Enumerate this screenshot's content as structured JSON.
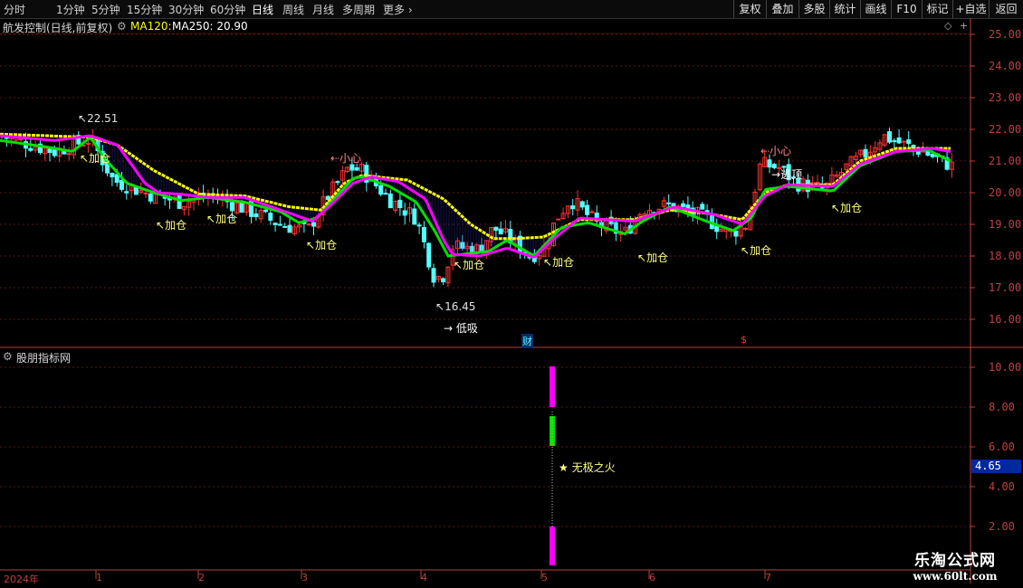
{
  "toolbar": {
    "periods": [
      "分时",
      "1分钟",
      "5分钟",
      "15分钟",
      "30分钟",
      "60分钟",
      "日线",
      "周线",
      "月线",
      "多周期",
      "更多 ›"
    ],
    "active_period": "日线",
    "right_buttons": [
      "复权",
      "叠加",
      "多股",
      "统计",
      "画线",
      "F10",
      "标记",
      "+自选",
      "返回"
    ]
  },
  "main_chart": {
    "title": "航发控制(日线,前复权)",
    "indicators_text": "MA120: MA250: 20.90",
    "ma120_label": "MA120:",
    "ma250_label": "MA250: 20.90",
    "y_axis": [
      "25.00",
      "24.00",
      "23.00",
      "22.00",
      "21.00",
      "20.00",
      "19.00",
      "18.00",
      "17.00",
      "16.00"
    ],
    "high_label": "22.51",
    "low_label": "16.45",
    "low_signal": "→ 低吸",
    "caution_labels": [
      "小心",
      "小心"
    ],
    "escape_label": "逃顶",
    "add_labels": [
      "加仓",
      "加仓",
      "加仓",
      "加仓",
      "加仓",
      "加仓",
      "加仓",
      "加仓",
      "加仓"
    ],
    "markers": [
      "财",
      "$"
    ]
  },
  "sub_chart": {
    "title": "股朋指标网",
    "y_axis": [
      "10.00",
      "8.00",
      "6.00",
      "4.00",
      "2.00"
    ],
    "current_value": "4.65",
    "signal_label": "★ 无极之火"
  },
  "x_axis": {
    "labels": [
      "2024年",
      "1",
      "2",
      "3",
      "4",
      "5",
      "6",
      "7"
    ]
  },
  "watermark": {
    "title": "乐淘公式网",
    "url": "www.60lt.com"
  },
  "colors": {
    "up": "#ff3232",
    "down": "#54ffff",
    "ma_fast": "#00e000",
    "ma_mid": "#ff00ff",
    "ma_slow": "#ffff00",
    "axis": "#c04040"
  }
}
